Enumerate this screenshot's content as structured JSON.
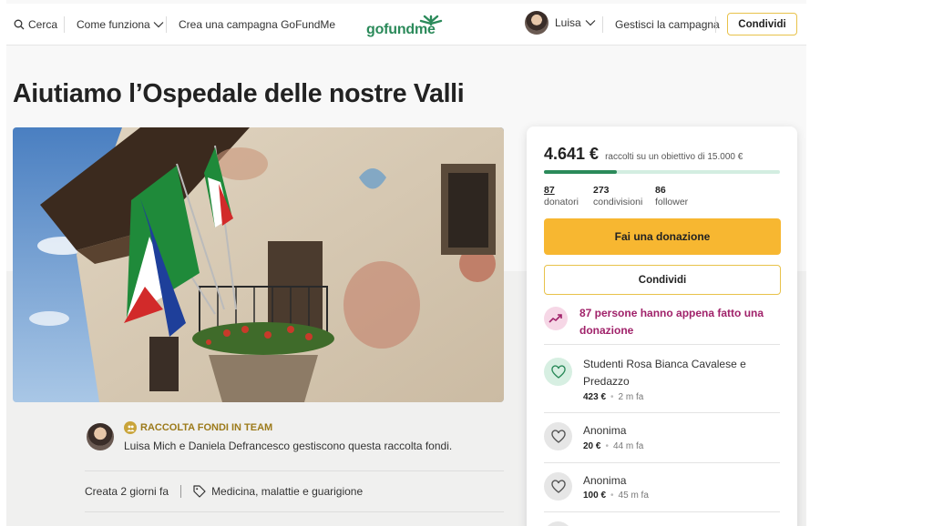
{
  "header": {
    "search_label": "Cerca",
    "how_it_works_label": "Come funziona",
    "create_label": "Crea una campagna GoFundMe",
    "logo_text": "gofundme",
    "user_name": "Luisa",
    "manage_label": "Gestisci la campagna",
    "share_label": "Condividi"
  },
  "campaign": {
    "title": "Aiutiamo l’Ospedale delle nostre Valli"
  },
  "card": {
    "raised": "4.641 €",
    "raised_sub": "raccolti su un obiettivo di 15.000 €",
    "progress_fraction": 0.31,
    "stats": [
      {
        "value": "87",
        "label": "donatori"
      },
      {
        "value": "273",
        "label": "condivisioni"
      },
      {
        "value": "86",
        "label": "follower"
      }
    ],
    "donate_label": "Fai una donazione",
    "share_label": "Condividi",
    "recent_text": "87 persone hanno appena fatto una donazione",
    "donations": [
      {
        "name": "Studenti Rosa Bianca Cavalese e Predazzo",
        "amount": "423 €",
        "time": "2 m fa"
      },
      {
        "name": "Anonima",
        "amount": "20 €",
        "time": "44 m fa"
      },
      {
        "name": "Anonima",
        "amount": "100 €",
        "time": "45 m fa"
      }
    ]
  },
  "team": {
    "badge": "RACCOLTA FONDI IN TEAM",
    "description": "Luisa Mich e Daniela Defrancesco gestiscono questa raccolta fondi."
  },
  "meta": {
    "created": "Creata 2 giorni fa",
    "category": "Medicina, malattie e guarigione"
  },
  "colors": {
    "brand_green": "#2b8a5a",
    "donate_yellow": "#f7b731",
    "trend_magenta": "#a0226a"
  }
}
